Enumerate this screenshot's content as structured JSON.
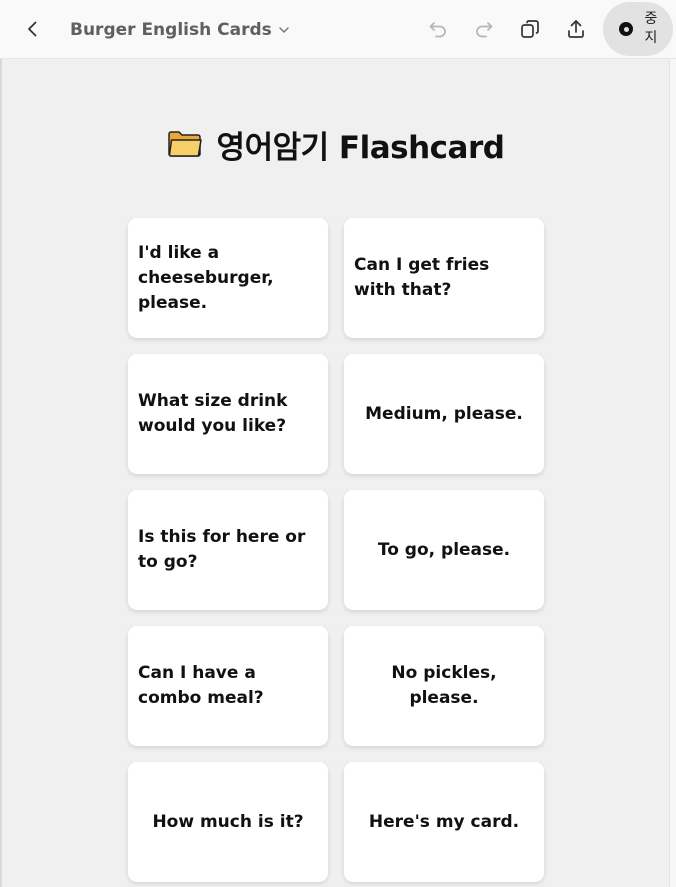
{
  "toolbar": {
    "title": "Burger English Cards",
    "stop_label": "중지",
    "icons": {
      "back": "chevron-left-icon",
      "title_dropdown": "chevron-down-icon",
      "undo": "undo-icon",
      "redo": "redo-icon",
      "copy": "copy-icon",
      "share": "share-icon",
      "stop": "stop-record-icon"
    }
  },
  "main": {
    "heading_icon": "folder-icon",
    "heading": "영어암기 Flashcard",
    "cards": [
      {
        "text": "I'd like a cheeseburger, please."
      },
      {
        "text": "Can I get fries with that?"
      },
      {
        "text": "What size drink would you like?"
      },
      {
        "text": "Medium, please."
      },
      {
        "text": "Is this for here or to go?"
      },
      {
        "text": "To go, please."
      },
      {
        "text": "Can I have a combo meal?"
      },
      {
        "text": "No pickles, please."
      },
      {
        "text": "How much is it?"
      },
      {
        "text": "Here's my card."
      }
    ]
  },
  "colors": {
    "background": "#f0f0f0",
    "card": "#ffffff",
    "text": "#111111",
    "folder": "#f6cf6a"
  }
}
